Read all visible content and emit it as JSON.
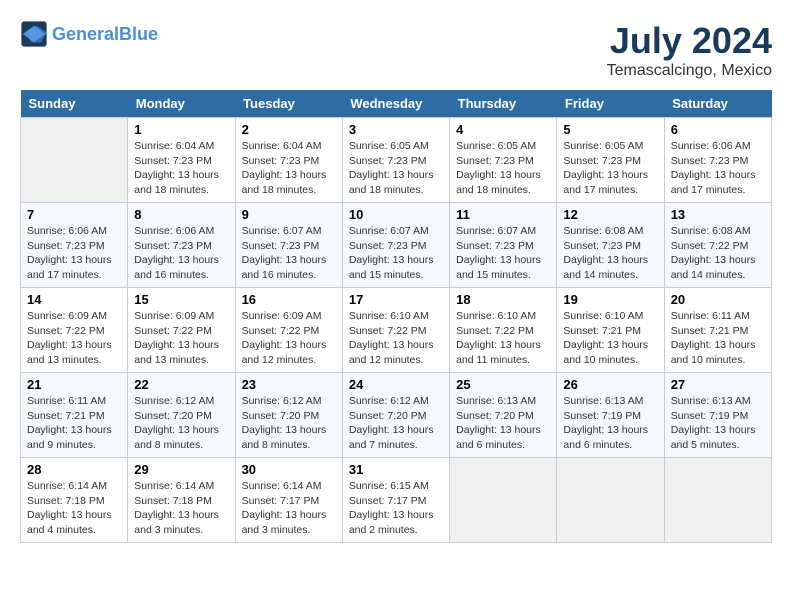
{
  "header": {
    "logo_general": "General",
    "logo_blue": "Blue",
    "month_year": "July 2024",
    "location": "Temascalcingo, Mexico"
  },
  "days_of_week": [
    "Sunday",
    "Monday",
    "Tuesday",
    "Wednesday",
    "Thursday",
    "Friday",
    "Saturday"
  ],
  "weeks": [
    [
      {
        "day": "",
        "sunrise": "",
        "sunset": "",
        "daylight": ""
      },
      {
        "day": "1",
        "sunrise": "Sunrise: 6:04 AM",
        "sunset": "Sunset: 7:23 PM",
        "daylight": "Daylight: 13 hours and 18 minutes."
      },
      {
        "day": "2",
        "sunrise": "Sunrise: 6:04 AM",
        "sunset": "Sunset: 7:23 PM",
        "daylight": "Daylight: 13 hours and 18 minutes."
      },
      {
        "day": "3",
        "sunrise": "Sunrise: 6:05 AM",
        "sunset": "Sunset: 7:23 PM",
        "daylight": "Daylight: 13 hours and 18 minutes."
      },
      {
        "day": "4",
        "sunrise": "Sunrise: 6:05 AM",
        "sunset": "Sunset: 7:23 PM",
        "daylight": "Daylight: 13 hours and 18 minutes."
      },
      {
        "day": "5",
        "sunrise": "Sunrise: 6:05 AM",
        "sunset": "Sunset: 7:23 PM",
        "daylight": "Daylight: 13 hours and 17 minutes."
      },
      {
        "day": "6",
        "sunrise": "Sunrise: 6:06 AM",
        "sunset": "Sunset: 7:23 PM",
        "daylight": "Daylight: 13 hours and 17 minutes."
      }
    ],
    [
      {
        "day": "7",
        "sunrise": "Sunrise: 6:06 AM",
        "sunset": "Sunset: 7:23 PM",
        "daylight": "Daylight: 13 hours and 17 minutes."
      },
      {
        "day": "8",
        "sunrise": "Sunrise: 6:06 AM",
        "sunset": "Sunset: 7:23 PM",
        "daylight": "Daylight: 13 hours and 16 minutes."
      },
      {
        "day": "9",
        "sunrise": "Sunrise: 6:07 AM",
        "sunset": "Sunset: 7:23 PM",
        "daylight": "Daylight: 13 hours and 16 minutes."
      },
      {
        "day": "10",
        "sunrise": "Sunrise: 6:07 AM",
        "sunset": "Sunset: 7:23 PM",
        "daylight": "Daylight: 13 hours and 15 minutes."
      },
      {
        "day": "11",
        "sunrise": "Sunrise: 6:07 AM",
        "sunset": "Sunset: 7:23 PM",
        "daylight": "Daylight: 13 hours and 15 minutes."
      },
      {
        "day": "12",
        "sunrise": "Sunrise: 6:08 AM",
        "sunset": "Sunset: 7:23 PM",
        "daylight": "Daylight: 13 hours and 14 minutes."
      },
      {
        "day": "13",
        "sunrise": "Sunrise: 6:08 AM",
        "sunset": "Sunset: 7:22 PM",
        "daylight": "Daylight: 13 hours and 14 minutes."
      }
    ],
    [
      {
        "day": "14",
        "sunrise": "Sunrise: 6:09 AM",
        "sunset": "Sunset: 7:22 PM",
        "daylight": "Daylight: 13 hours and 13 minutes."
      },
      {
        "day": "15",
        "sunrise": "Sunrise: 6:09 AM",
        "sunset": "Sunset: 7:22 PM",
        "daylight": "Daylight: 13 hours and 13 minutes."
      },
      {
        "day": "16",
        "sunrise": "Sunrise: 6:09 AM",
        "sunset": "Sunset: 7:22 PM",
        "daylight": "Daylight: 13 hours and 12 minutes."
      },
      {
        "day": "17",
        "sunrise": "Sunrise: 6:10 AM",
        "sunset": "Sunset: 7:22 PM",
        "daylight": "Daylight: 13 hours and 12 minutes."
      },
      {
        "day": "18",
        "sunrise": "Sunrise: 6:10 AM",
        "sunset": "Sunset: 7:22 PM",
        "daylight": "Daylight: 13 hours and 11 minutes."
      },
      {
        "day": "19",
        "sunrise": "Sunrise: 6:10 AM",
        "sunset": "Sunset: 7:21 PM",
        "daylight": "Daylight: 13 hours and 10 minutes."
      },
      {
        "day": "20",
        "sunrise": "Sunrise: 6:11 AM",
        "sunset": "Sunset: 7:21 PM",
        "daylight": "Daylight: 13 hours and 10 minutes."
      }
    ],
    [
      {
        "day": "21",
        "sunrise": "Sunrise: 6:11 AM",
        "sunset": "Sunset: 7:21 PM",
        "daylight": "Daylight: 13 hours and 9 minutes."
      },
      {
        "day": "22",
        "sunrise": "Sunrise: 6:12 AM",
        "sunset": "Sunset: 7:20 PM",
        "daylight": "Daylight: 13 hours and 8 minutes."
      },
      {
        "day": "23",
        "sunrise": "Sunrise: 6:12 AM",
        "sunset": "Sunset: 7:20 PM",
        "daylight": "Daylight: 13 hours and 8 minutes."
      },
      {
        "day": "24",
        "sunrise": "Sunrise: 6:12 AM",
        "sunset": "Sunset: 7:20 PM",
        "daylight": "Daylight: 13 hours and 7 minutes."
      },
      {
        "day": "25",
        "sunrise": "Sunrise: 6:13 AM",
        "sunset": "Sunset: 7:20 PM",
        "daylight": "Daylight: 13 hours and 6 minutes."
      },
      {
        "day": "26",
        "sunrise": "Sunrise: 6:13 AM",
        "sunset": "Sunset: 7:19 PM",
        "daylight": "Daylight: 13 hours and 6 minutes."
      },
      {
        "day": "27",
        "sunrise": "Sunrise: 6:13 AM",
        "sunset": "Sunset: 7:19 PM",
        "daylight": "Daylight: 13 hours and 5 minutes."
      }
    ],
    [
      {
        "day": "28",
        "sunrise": "Sunrise: 6:14 AM",
        "sunset": "Sunset: 7:18 PM",
        "daylight": "Daylight: 13 hours and 4 minutes."
      },
      {
        "day": "29",
        "sunrise": "Sunrise: 6:14 AM",
        "sunset": "Sunset: 7:18 PM",
        "daylight": "Daylight: 13 hours and 3 minutes."
      },
      {
        "day": "30",
        "sunrise": "Sunrise: 6:14 AM",
        "sunset": "Sunset: 7:17 PM",
        "daylight": "Daylight: 13 hours and 3 minutes."
      },
      {
        "day": "31",
        "sunrise": "Sunrise: 6:15 AM",
        "sunset": "Sunset: 7:17 PM",
        "daylight": "Daylight: 13 hours and 2 minutes."
      },
      {
        "day": "",
        "sunrise": "",
        "sunset": "",
        "daylight": ""
      },
      {
        "day": "",
        "sunrise": "",
        "sunset": "",
        "daylight": ""
      },
      {
        "day": "",
        "sunrise": "",
        "sunset": "",
        "daylight": ""
      }
    ]
  ]
}
